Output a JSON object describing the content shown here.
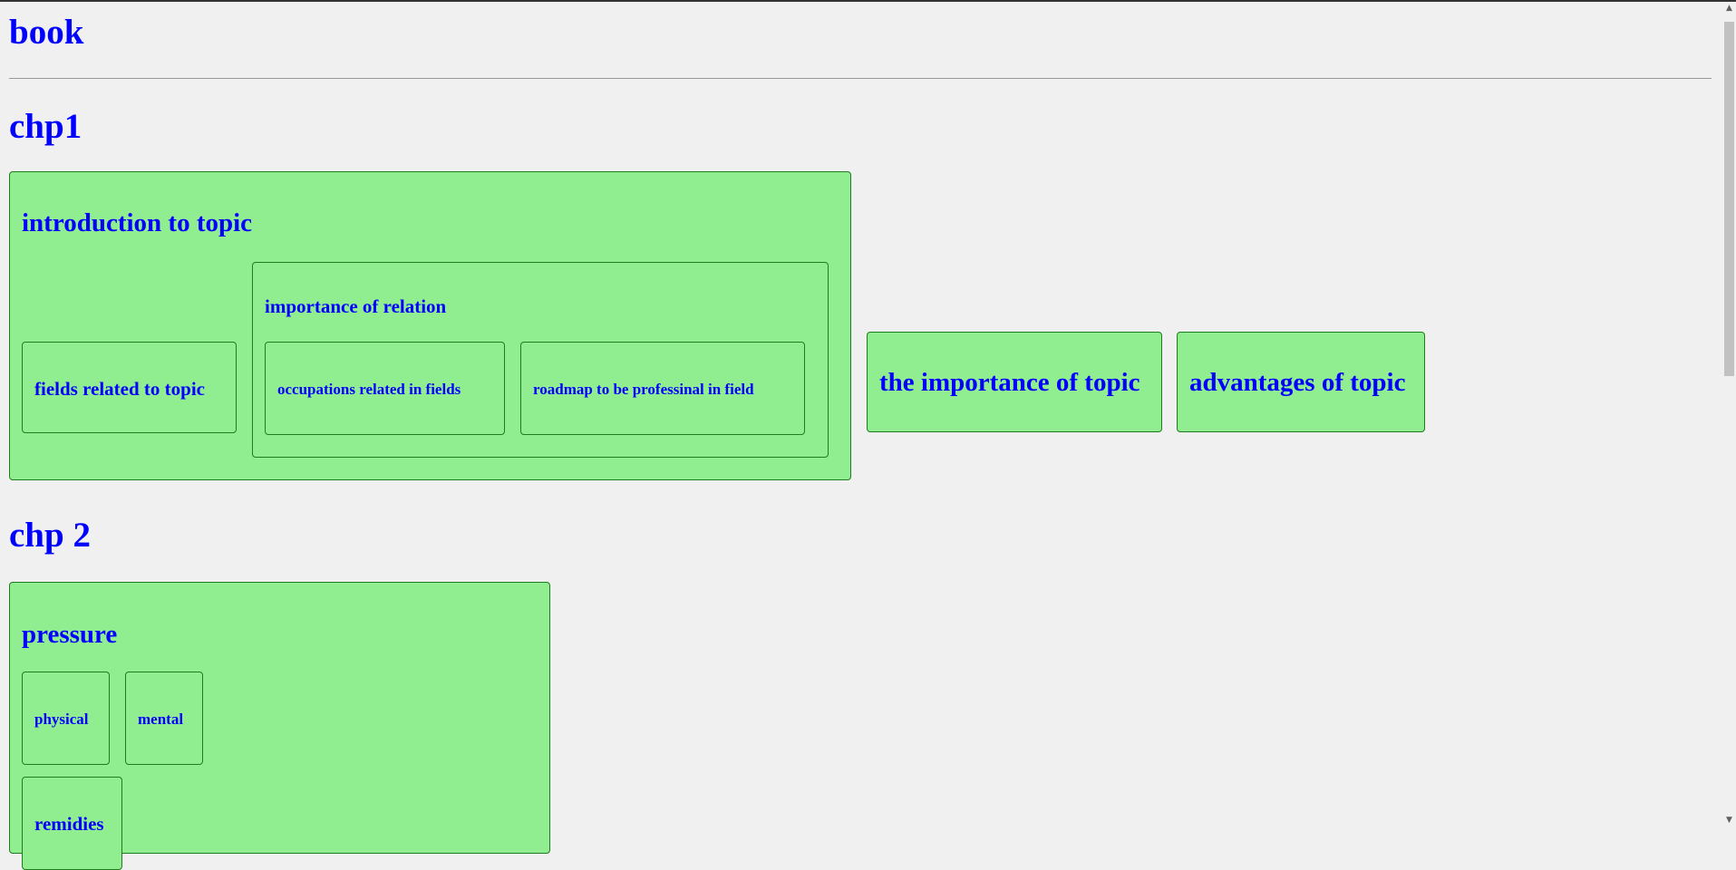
{
  "headings": {
    "book": "book",
    "chp1": "chp1",
    "chp2": "chp 2"
  },
  "chp1": {
    "intro": {
      "title": "introduction to topic",
      "fields": "fields related to topic",
      "importance_relation": {
        "title": "importance of relation",
        "occupations": "occupations related in fields",
        "roadmap": "roadmap to be professinal in field"
      }
    },
    "importance_topic": "the importance of topic",
    "advantages_topic": "advantages of topic"
  },
  "chp2": {
    "pressure": {
      "title": "pressure",
      "physical": "physical",
      "mental": "mental",
      "remidies": "remidies"
    }
  },
  "colors": {
    "text": "#0000ff",
    "box_fill": "#90ee90",
    "box_border": "#1e7b1e",
    "background": "#f0f0f0"
  }
}
